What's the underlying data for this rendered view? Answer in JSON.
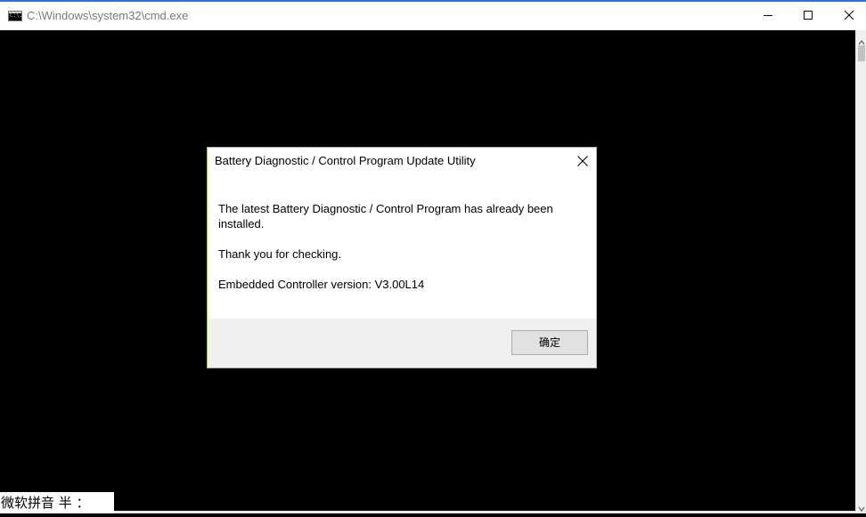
{
  "window": {
    "title": "C:\\Windows\\system32\\cmd.exe",
    "icon": "cmd-icon",
    "icon_text": "C:\\."
  },
  "colors": {
    "console_bg": "#000000",
    "titlebar_bg": "#ffffff",
    "title_text": "#7a7a7a",
    "dialog_border": "#9bc36a",
    "dialog_footer_bg": "#f0f0f0",
    "accent": "#2f6fd6"
  },
  "dialog": {
    "title": "Battery Diagnostic / Control Program Update Utility",
    "messages": [
      "The latest Battery Diagnostic / Control Program has already been installed.",
      "Thank you for checking.",
      "Embedded Controller version: V3.00L14"
    ],
    "ok_label": "确定"
  },
  "ime": {
    "text": "微软拼音 半 ："
  }
}
